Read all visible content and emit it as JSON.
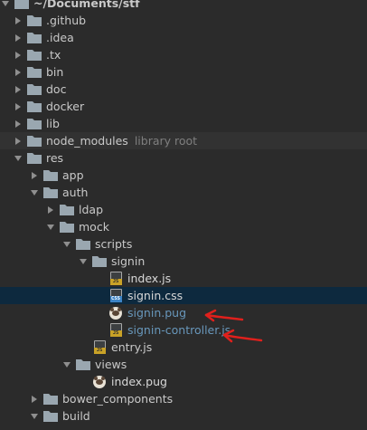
{
  "tree": [
    {
      "label": "~/Documents/stf",
      "type": "root",
      "arrow": "expanded"
    },
    {
      "label": ".github",
      "type": "folder",
      "arrow": "collapsed",
      "icon": "folder-icon"
    },
    {
      "label": ".idea",
      "type": "folder",
      "arrow": "collapsed",
      "icon": "folder-icon"
    },
    {
      "label": ".tx",
      "type": "folder",
      "arrow": "collapsed",
      "icon": "folder-icon"
    },
    {
      "label": "bin",
      "type": "folder",
      "arrow": "collapsed",
      "icon": "folder-icon"
    },
    {
      "label": "doc",
      "type": "folder",
      "arrow": "collapsed",
      "icon": "folder-icon"
    },
    {
      "label": "docker",
      "type": "folder",
      "arrow": "collapsed",
      "icon": "folder-icon"
    },
    {
      "label": "lib",
      "type": "folder",
      "arrow": "collapsed",
      "icon": "folder-icon"
    },
    {
      "label": "node_modules",
      "extra": "library root",
      "type": "folder",
      "arrow": "collapsed",
      "icon": "folder-icon",
      "state": "hover"
    },
    {
      "label": "res",
      "type": "folder",
      "arrow": "expanded",
      "icon": "folder-icon"
    },
    {
      "label": "app",
      "type": "folder",
      "arrow": "collapsed",
      "icon": "folder-icon"
    },
    {
      "label": "auth",
      "type": "folder",
      "arrow": "expanded",
      "icon": "folder-icon"
    },
    {
      "label": "ldap",
      "type": "folder",
      "arrow": "collapsed",
      "icon": "folder-icon"
    },
    {
      "label": "mock",
      "type": "folder",
      "arrow": "expanded",
      "icon": "folder-icon"
    },
    {
      "label": "scripts",
      "type": "folder",
      "arrow": "expanded",
      "icon": "folder-icon"
    },
    {
      "label": "signin",
      "type": "folder",
      "arrow": "expanded",
      "icon": "folder-icon"
    },
    {
      "label": "index.js",
      "type": "file",
      "icon": "js-file-icon",
      "icon_tag": "JS"
    },
    {
      "label": "signin.css",
      "type": "file",
      "icon": "css-file-icon",
      "icon_tag": "CSS",
      "state": "selected"
    },
    {
      "label": "signin.pug",
      "type": "file",
      "icon": "pug-file-icon",
      "style": "modified"
    },
    {
      "label": "signin-controller.js",
      "type": "file",
      "icon": "js-file-icon",
      "icon_tag": "JS",
      "style": "modified"
    },
    {
      "label": "entry.js",
      "type": "file",
      "icon": "js-file-icon",
      "icon_tag": "JS"
    },
    {
      "label": "views",
      "type": "folder",
      "arrow": "expanded",
      "icon": "folder-icon"
    },
    {
      "label": "index.pug",
      "type": "file",
      "icon": "pug-file-icon"
    },
    {
      "label": "bower_components",
      "type": "folder",
      "arrow": "collapsed",
      "icon": "folder-icon"
    },
    {
      "label": "build",
      "type": "folder",
      "arrow": "expanded",
      "icon": "folder-icon"
    }
  ],
  "colors": {
    "background": "#2b2b2b",
    "selected_row": "#0d293e",
    "hover_row": "#323232",
    "folder": "#9aa7b0",
    "modified_text": "#6897bb",
    "annotation_arrow": "#e0201c"
  }
}
